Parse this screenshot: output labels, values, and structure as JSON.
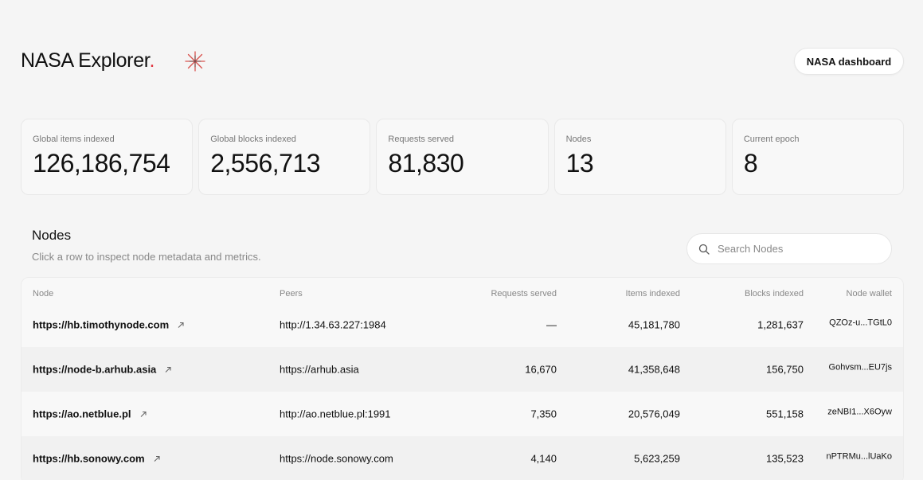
{
  "header": {
    "brand": "NASA Explorer",
    "brand_dot": ".",
    "dashboard_button": "NASA dashboard"
  },
  "stats": [
    {
      "label": "Global items indexed",
      "value": "126,186,754"
    },
    {
      "label": "Global blocks indexed",
      "value": "2,556,713"
    },
    {
      "label": "Requests served",
      "value": "81,830"
    },
    {
      "label": "Nodes",
      "value": "13"
    },
    {
      "label": "Current epoch",
      "value": "8"
    }
  ],
  "nodes_section": {
    "title": "Nodes",
    "subtitle": "Click a row to inspect node metadata and metrics.",
    "search_placeholder": "Search Nodes"
  },
  "table": {
    "columns": [
      "Node",
      "Peers",
      "Requests served",
      "Items indexed",
      "Blocks indexed",
      "Node wallet"
    ],
    "rows": [
      {
        "node": "https://hb.timothynode.com",
        "peers": "http://1.34.63.227:1984",
        "requests": "—",
        "items": "45,181,780",
        "blocks": "1,281,637",
        "wallet": "QZOz-u...TGtL0"
      },
      {
        "node": "https://node-b.arhub.asia",
        "peers": "https://arhub.asia",
        "requests": "16,670",
        "items": "41,358,648",
        "blocks": "156,750",
        "wallet": "Gohvsm...EU7js"
      },
      {
        "node": "https://ao.netblue.pl",
        "peers": "http://ao.netblue.pl:1991",
        "requests": "7,350",
        "items": "20,576,049",
        "blocks": "551,158",
        "wallet": "zeNBI1...X6Oyw"
      },
      {
        "node": "https://hb.sonowy.com",
        "peers": "https://node.sonowy.com",
        "requests": "4,140",
        "items": "5,623,259",
        "blocks": "135,523",
        "wallet": "nPTRMu...lUaKo"
      }
    ]
  },
  "colors": {
    "accent": "#e0303a",
    "background": "#f5f5f5"
  }
}
